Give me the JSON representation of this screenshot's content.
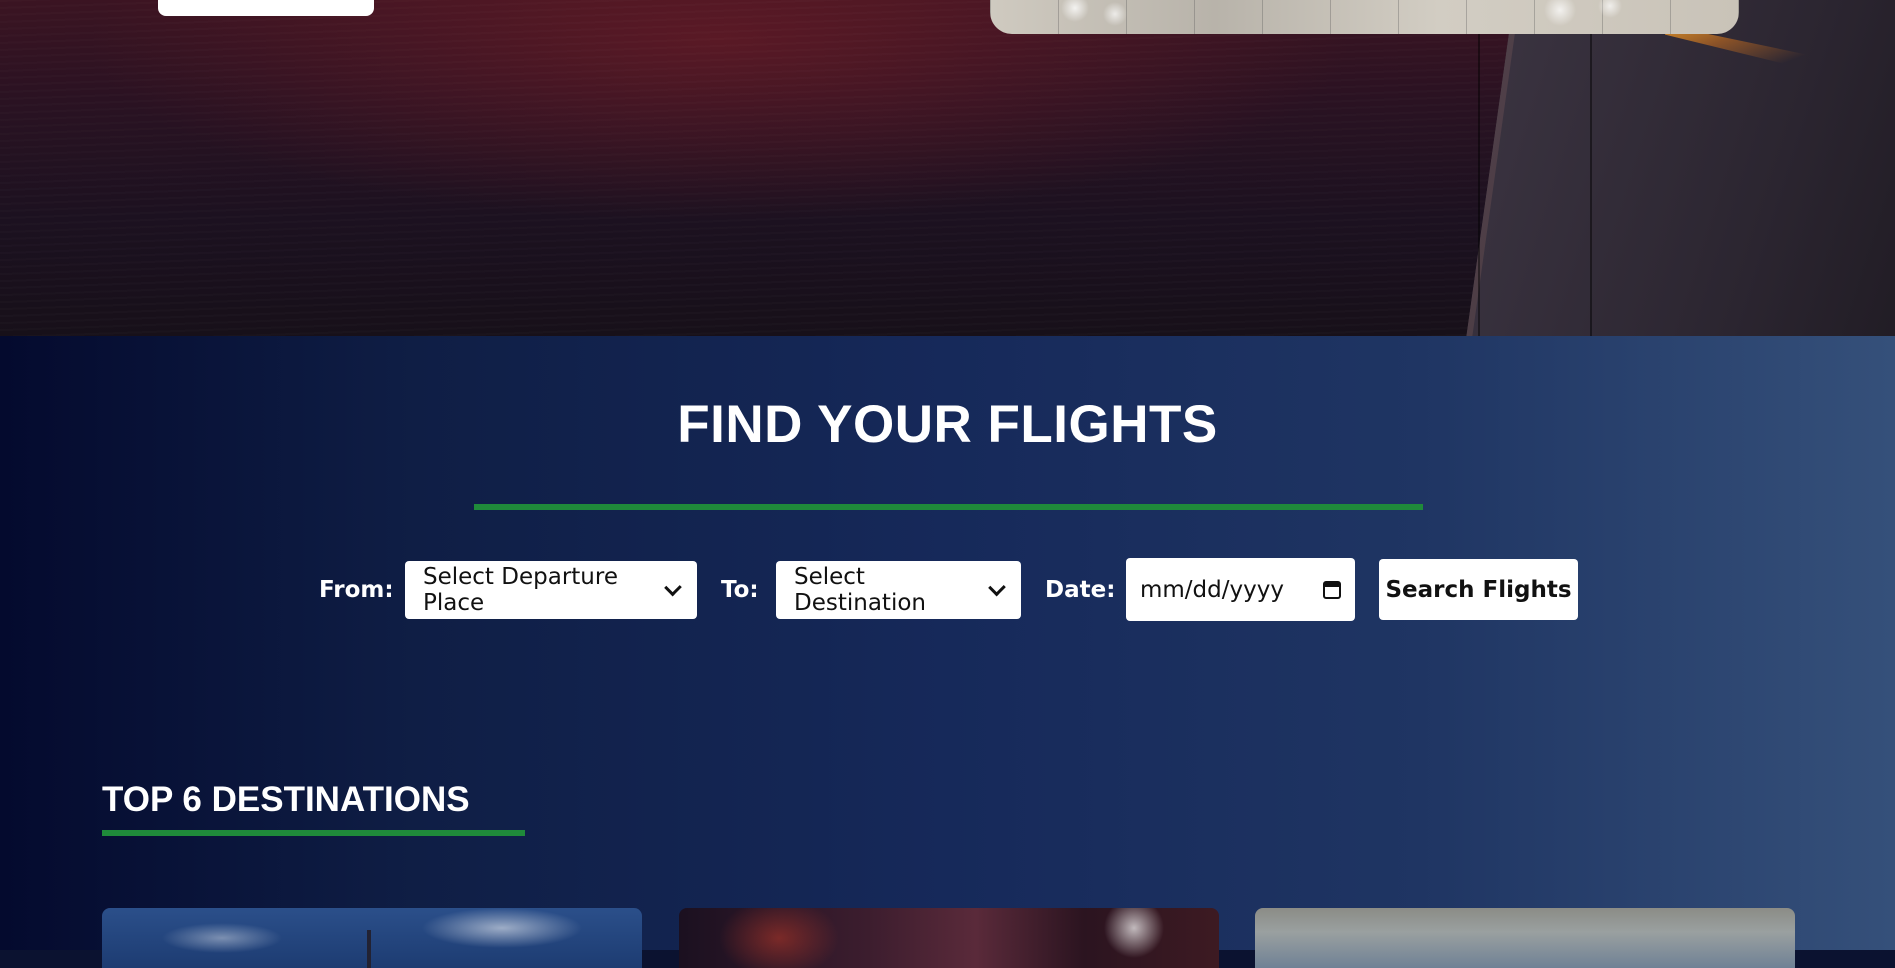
{
  "search": {
    "title": "FIND YOUR FLIGHTS",
    "from_label": "From:",
    "from_placeholder": "Select Departure Place",
    "to_label": "To:",
    "to_placeholder": "Select Destination",
    "date_label": "Date:",
    "date_placeholder": "mm/dd/yyyy",
    "date_icon": "calendar-icon",
    "search_button": "Search Flights"
  },
  "destinations": {
    "heading": "TOP 6 DESTINATIONS",
    "visible_cards": 3
  },
  "colors": {
    "accent_green": "#1f8a3a",
    "section_gradient_start": "#040a2e",
    "section_gradient_end": "#35507a"
  }
}
